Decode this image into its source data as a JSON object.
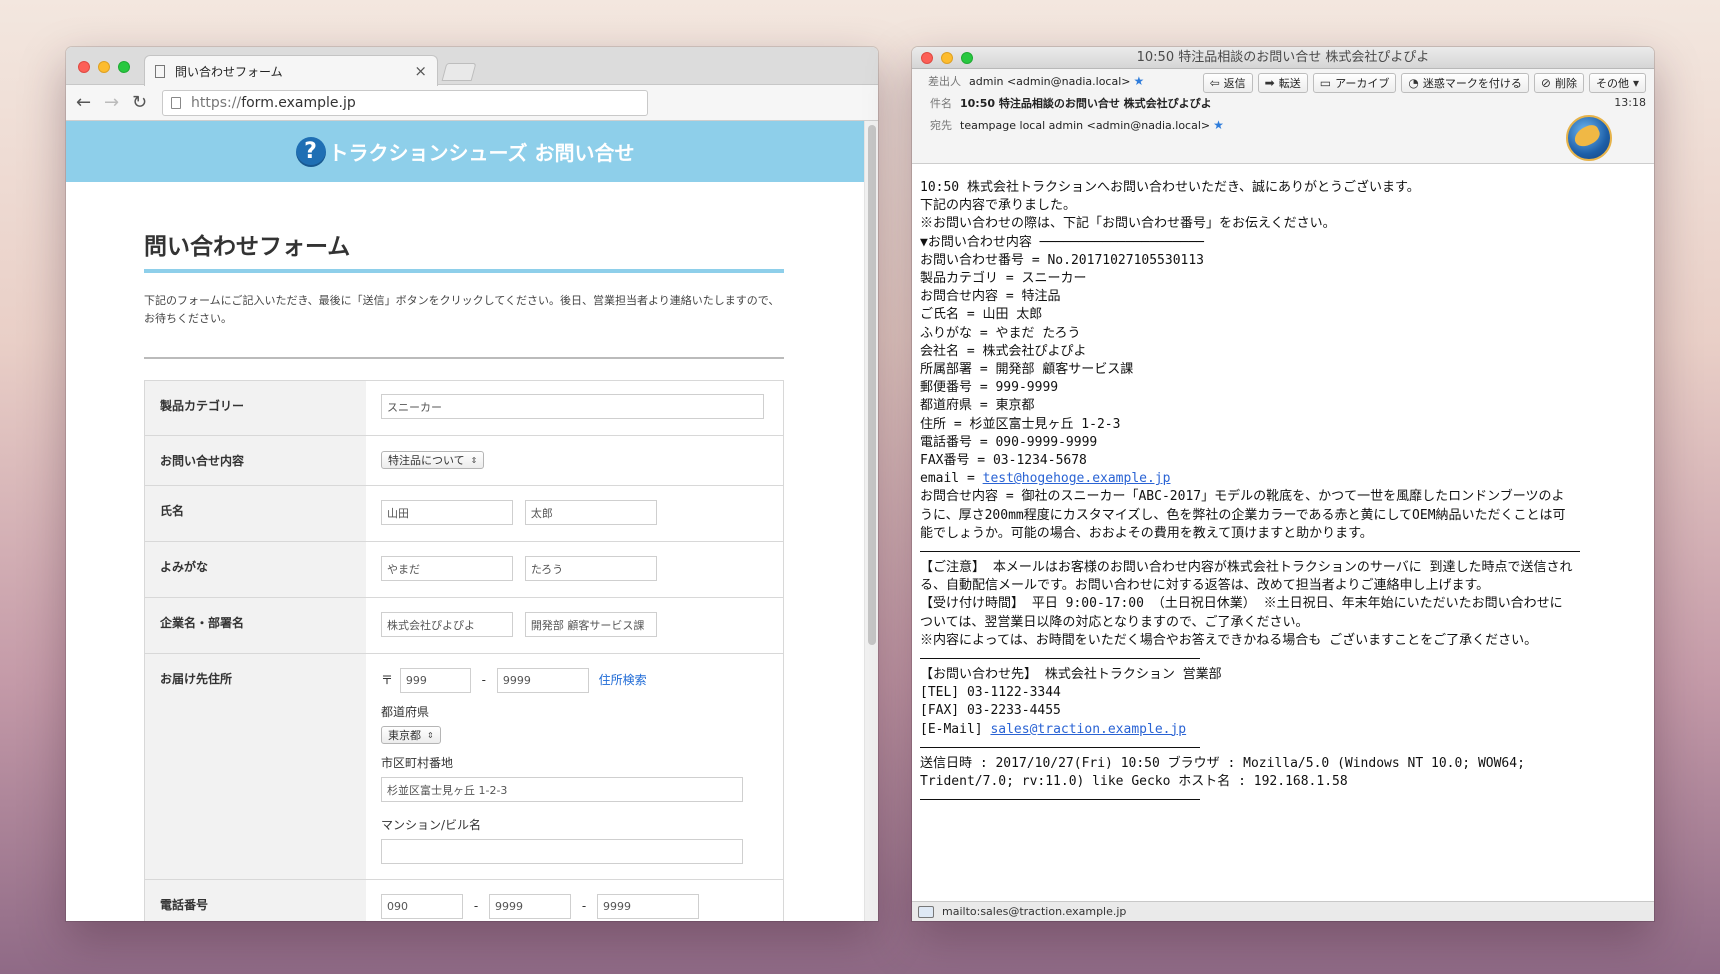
{
  "browser": {
    "tab_title": "問い合わせフォーム",
    "tab_close": "×",
    "url_scheme": "https://",
    "url_host": "form.example.jp",
    "back": "←",
    "forward": "→",
    "reload": "↻"
  },
  "site": {
    "header_title": "トラクションシューズ お問い合せ",
    "header_icon": "?",
    "form_title": "問い合わせフォーム",
    "intro": "下記のフォームにご記入いただき、最後に「送信」ボタンをクリックしてください。後日、営業担当者より連絡いたしますので、お待ちください。"
  },
  "form": {
    "category": {
      "label": "製品カテゴリー",
      "value": "スニーカー"
    },
    "inquiry": {
      "label": "お問い合せ内容",
      "selected": "特注品について",
      "arrow": "⇕"
    },
    "name": {
      "label": "氏名",
      "last": "山田",
      "first": "太郎"
    },
    "kana": {
      "label": "よみがな",
      "last": "やまだ",
      "first": "たろう"
    },
    "company": {
      "label": "企業名・部署名",
      "company": "株式会社ぴよぴよ",
      "dept": "開発部 顧客サービス課"
    },
    "address": {
      "label": "お届け先住所",
      "zip_mark": "〒",
      "zip1": "999",
      "zip2": "9999",
      "dash": "-",
      "search_link": "住所検索",
      "pref_label": "都道府県",
      "pref_value": "東京都",
      "city_label": "市区町村番地",
      "city_value": "杉並区富士見ヶ丘 1-2-3",
      "bldg_label": "マンション/ビル名",
      "bldg_value": ""
    },
    "phone": {
      "label": "電話番号",
      "p1": "090",
      "p2": "9999",
      "p3": "9999"
    }
  },
  "mail": {
    "window_title": "10:50 特注品相談のお問い合せ 株式会社ぴよぴよ",
    "from_label": "差出人",
    "from_value": "admin <admin@nadia.local>",
    "subject_label": "件名",
    "subject_value": "10:50 特注品相談のお問い合せ 株式会社ぴよぴよ",
    "to_label": "宛先",
    "to_value": "teampage local admin <admin@nadia.local>",
    "time": "13:18",
    "star": "★",
    "actions": {
      "reply": "返信",
      "forward": "転送",
      "archive": "アーカイブ",
      "junk": "迷惑マークを付ける",
      "delete": "削除",
      "other": "その他"
    },
    "action_icons": {
      "reply": "⇦",
      "forward": "➡",
      "archive": "▭",
      "junk": "◔",
      "delete": "⊘",
      "other": "▾"
    },
    "body": {
      "l1": "10:50 株式会社トラクションへお問い合わせいただき、誠にありがとうございます。",
      "l2": "下記の内容で承りました。",
      "l3": "※お問い合わせの際は、下記「お問い合わせ番号」をお伝えください。",
      "l4": "▼お問い合わせ内容 ─────────────────────",
      "l5": "お問い合わせ番号 = No.20171027105530113",
      "l6": "製品カテゴリ = スニーカー",
      "l7": "お問合せ内容 = 特注品",
      "l8": "ご氏名 = 山田 太郎",
      "l9": "ふりがな = やまだ たろう",
      "l10": "会社名 = 株式会社ぴよぴよ",
      "l11": "所属部署 = 開発部 顧客サービス課",
      "l12": "郵便番号 = 999-9999",
      "l13": "都道府県 = 東京都",
      "l14": "住所 = 杉並区富士見ヶ丘 1-2-3",
      "l15": "電話番号 = 090-9999-9999",
      "l16": "FAX番号 = 03-1234-5678",
      "email_prefix": "email = ",
      "email_link": "test@hogehoge.example.jp",
      "l18": "お問合せ内容 = 御社のスニーカー「ABC-2017」モデルの靴底を、かつて一世を風靡したロンドンブーツのよ",
      "l19": "うに、厚さ200mm程度にカスタマイズし、色を弊社の企業カラーである赤と黄にしてOEM納品いただくことは可",
      "l20": "能でしょうか。可能の場合、おおよその費用を教えて頂けますと助かります。",
      "n1": "【ご注意】 本メールはお客様のお問い合わせ内容が株式会社トラクションのサーバに 到達した時点で送信され",
      "n2": "る、自動配信メールです。お問い合わせに対する返答は、改めて担当者よりご連絡申し上げます。",
      "n3": "【受け付け時間】 平日 9:00-17:00 （土日祝日休業） ※土日祝日、年末年始にいただいたお問い合わせに",
      "n4": "ついては、翌営業日以降の対応となりますので、ご了承ください。",
      "n5": "※内容によっては、お時間をいただく場合やお答えできかねる場合も ございますことをご了承ください。",
      "c1": "【お問い合わせ先】 株式会社トラクション 営業部",
      "c2": "[TEL] 03-1122-3344",
      "c3": "[FAX] 03-2233-4455",
      "c4_prefix": "[E-Mail] ",
      "c4_link": "sales@traction.example.jp",
      "s1": "送信日時 : 2017/10/27(Fri) 10:50 ブラウザ : Mozilla/5.0 (Windows NT 10.0; WOW64;",
      "s2": "Trident/7.0; rv:11.0) like Gecko ホスト名 : 192.168.1.58"
    },
    "status": "mailto:sales@traction.example.jp"
  }
}
